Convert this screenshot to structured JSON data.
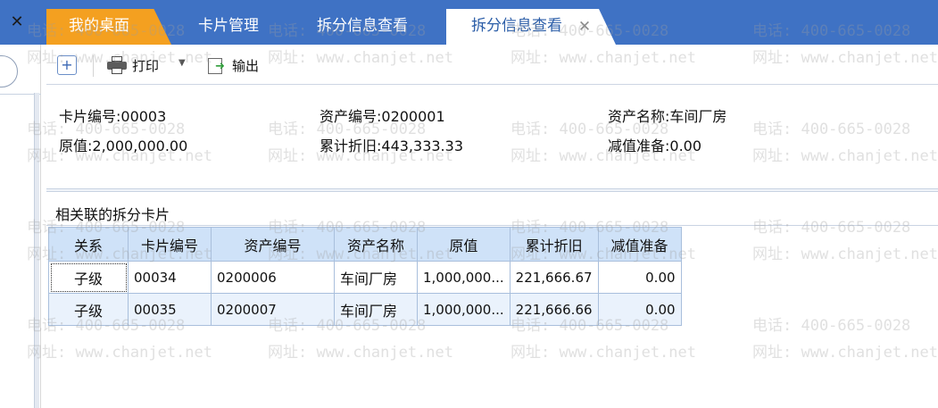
{
  "tabs": [
    {
      "label": "我的桌面"
    },
    {
      "label": "卡片管理"
    },
    {
      "label": "拆分信息查看"
    },
    {
      "label": "拆分信息查看"
    }
  ],
  "active_tab_close": "✕",
  "left_close": "✕",
  "toolbar": {
    "add_symbol": "+",
    "print_label": "打印",
    "dropdown_symbol": "▼",
    "export_label": "输出"
  },
  "info": {
    "card_no": "卡片编号:00003",
    "asset_no": "资产编号:0200001",
    "asset_name": "资产名称:车间厂房",
    "original_value": "原值:2,000,000.00",
    "accum_depr": "累计折旧:443,333.33",
    "impairment": "减值准备:0.00"
  },
  "related_title": "相关联的拆分卡片",
  "grid": {
    "columns": [
      "关系",
      "卡片编号",
      "资产编号",
      "资产名称",
      "原值",
      "累计折旧",
      "减值准备"
    ],
    "rows": [
      {
        "relation": "子级",
        "card_no": "00034",
        "asset_no": "0200006",
        "asset_name": "车间厂房",
        "original": "1,000,000...",
        "accum": "221,666.67",
        "impairment": "0.00"
      },
      {
        "relation": "子级",
        "card_no": "00035",
        "asset_no": "0200007",
        "asset_name": "车间厂房",
        "original": "1,000,000...",
        "accum": "221,666.66",
        "impairment": "0.00"
      }
    ]
  },
  "watermark": {
    "phone": "电话: 400-665-0028",
    "site": "网址: www.chanjet.net"
  }
}
